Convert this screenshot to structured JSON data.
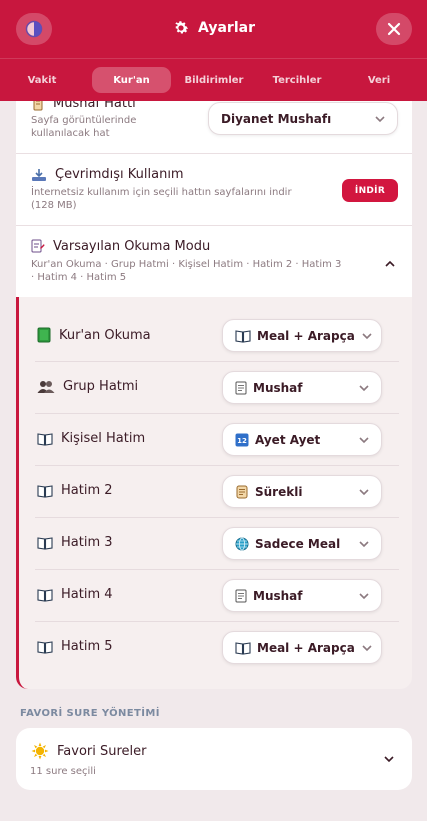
{
  "header": {
    "title": "Ayarlar",
    "theme_icon": "contrast-icon",
    "title_icon": "gear-icon",
    "close_icon": "close-icon"
  },
  "tabs": [
    {
      "label": "Vakit",
      "active": false
    },
    {
      "label": "Kur'an",
      "active": true
    },
    {
      "label": "Bildirimler",
      "active": false
    },
    {
      "label": "Tercihler",
      "active": false
    },
    {
      "label": "Veri",
      "active": false
    }
  ],
  "mushaf": {
    "title": "Mushaf Hattı",
    "subtitle_line1": "Sayfa görüntülerinde",
    "subtitle_line2": "kullanılacak hat",
    "selected": "Diyanet Mushafı"
  },
  "offline": {
    "title": "Çevrimdışı Kullanım",
    "subtitle_line1": "İnternetsiz kullanım için seçili hattın sayfalarını indir",
    "subtitle_line2": "(128 MB)",
    "button": "İNDİR"
  },
  "reading_mode": {
    "title": "Varsayılan Okuma Modu",
    "summary_line1": "Kur'an Okuma · Grup Hatmi · Kişisel Hatim · Hatim 2 · Hatim 3",
    "summary_line2": "· Hatim 4 · Hatim 5",
    "rows": [
      {
        "label": "Kur'an Okuma",
        "icon": "green-book-icon",
        "value": "Meal + Arapça",
        "value_icon": "book-icon"
      },
      {
        "label": "Grup Hatmi",
        "icon": "people-icon",
        "value": "Mushaf",
        "value_icon": "page-icon"
      },
      {
        "label": "Kişisel Hatim",
        "icon": "book-icon",
        "value": "Ayet Ayet",
        "value_icon": "numbers-icon"
      },
      {
        "label": "Hatim 2",
        "icon": "book-icon",
        "value": "Sürekli",
        "value_icon": "scroll-icon"
      },
      {
        "label": "Hatim 3",
        "icon": "book-icon",
        "value": "Sadece Meal",
        "value_icon": "globe-icon"
      },
      {
        "label": "Hatim 4",
        "icon": "book-icon",
        "value": "Mushaf",
        "value_icon": "page-icon"
      },
      {
        "label": "Hatim 5",
        "icon": "book-icon",
        "value": "Meal + Arapça",
        "value_icon": "book-icon"
      }
    ]
  },
  "favorites": {
    "section_title": "FAVORİ SURE YÖNETİMİ",
    "title": "Favori Sureler",
    "subtitle": "11 sure seçili"
  },
  "colors": {
    "brand": "#c8173e",
    "background": "#f1e9eb",
    "muted": "#8c7a80"
  }
}
